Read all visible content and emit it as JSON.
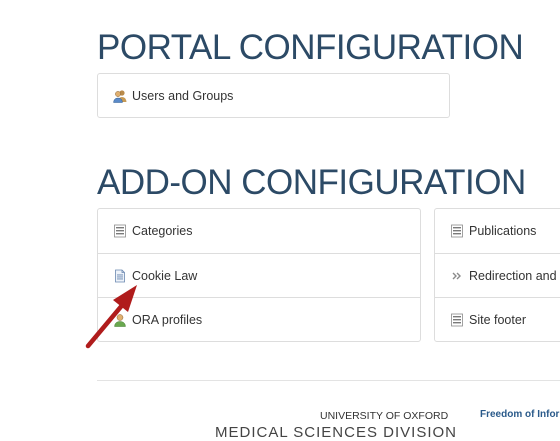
{
  "portal": {
    "title": "PORTAL CONFIGURATION",
    "items": [
      {
        "label": "Users and Groups",
        "icon": "users-icon"
      }
    ]
  },
  "addon": {
    "title": "ADD-ON CONFIGURATION",
    "left_items": [
      {
        "label": "Categories",
        "icon": "list-icon"
      },
      {
        "label": "Cookie Law",
        "icon": "document-icon"
      },
      {
        "label": "ORA profiles",
        "icon": "user-icon"
      }
    ],
    "right_items": [
      {
        "label": "Publications",
        "icon": "list-icon"
      },
      {
        "label": "Redirection and",
        "icon": "double-chevron-icon"
      },
      {
        "label": "Site footer",
        "icon": "list-icon"
      }
    ]
  },
  "footer": {
    "university": "UNIVERSITY OF OXFORD",
    "division": "MEDICAL SCIENCES DIVISION",
    "foi_link": "Freedom of Infor"
  },
  "annotation": {
    "arrow_color": "#b01c1c",
    "target": "Cookie Law"
  },
  "colors": {
    "heading": "#2c4a66",
    "border": "#dddddd",
    "link": "#2a5a8a"
  }
}
